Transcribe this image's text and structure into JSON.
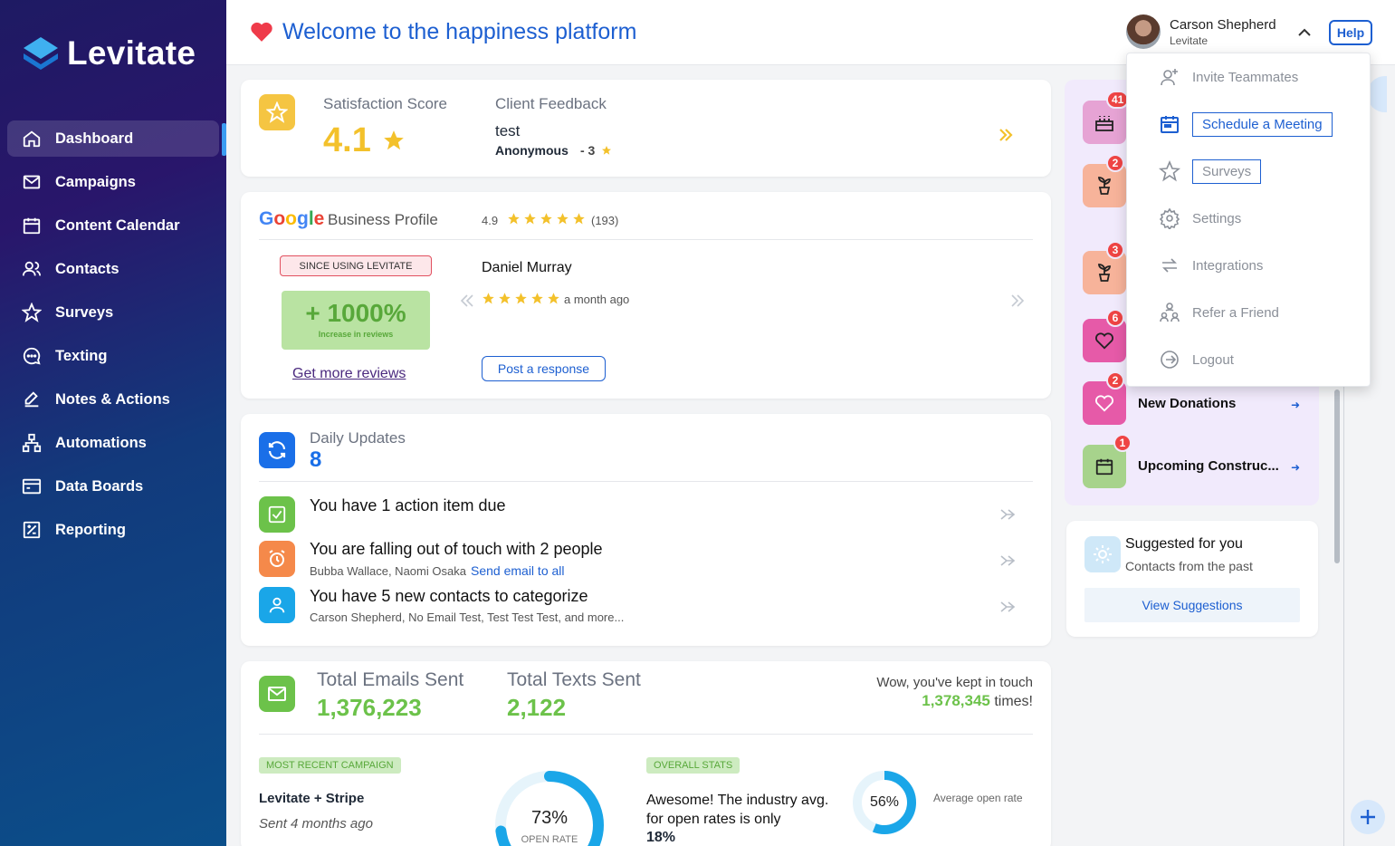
{
  "app": {
    "name": "Levitate"
  },
  "sidebar": {
    "items": [
      {
        "label": "Dashboard",
        "icon": "home-icon",
        "active": true
      },
      {
        "label": "Campaigns",
        "icon": "mail-icon"
      },
      {
        "label": "Content Calendar",
        "icon": "calendar-icon"
      },
      {
        "label": "Contacts",
        "icon": "users-icon"
      },
      {
        "label": "Surveys",
        "icon": "star-icon"
      },
      {
        "label": "Texting",
        "icon": "chat-icon"
      },
      {
        "label": "Notes & Actions",
        "icon": "pen-icon"
      },
      {
        "label": "Automations",
        "icon": "flow-icon"
      },
      {
        "label": "Data Boards",
        "icon": "board-icon"
      },
      {
        "label": "Reporting",
        "icon": "report-icon"
      }
    ]
  },
  "header": {
    "welcome": "Welcome to the happiness platform",
    "user_name": "Carson Shepherd",
    "user_org": "Levitate",
    "help": "Help"
  },
  "satisfaction": {
    "label": "Satisfaction Score",
    "score": "4.1",
    "feedback_label": "Client Feedback",
    "feedback_text": "test",
    "feedback_author": "Anonymous",
    "feedback_rating": "- 3"
  },
  "google": {
    "brand": "Google",
    "title": "Business Profile",
    "rating": "4.9",
    "review_count": "(193)",
    "since_label": "SINCE USING LEVITATE",
    "increase": "+ 1000%",
    "increase_sub": "Increase in reviews",
    "more_reviews": "Get more reviews",
    "reviewer": "Daniel Murray",
    "review_time": "a month ago",
    "post_response": "Post a response"
  },
  "daily": {
    "title": "Daily Updates",
    "count": "8",
    "items": [
      {
        "text": "You have 1 action item due",
        "sub": "",
        "link": ""
      },
      {
        "text": "You are falling out of touch with 2 people",
        "sub": "Bubba Wallace, Naomi Osaka",
        "link": "Send email to all"
      },
      {
        "text": "You have 5 new contacts to categorize",
        "sub": "Carson Shepherd, No Email Test, Test Test Test, and more...",
        "link": ""
      }
    ]
  },
  "stats": {
    "emails_label": "Total Emails Sent",
    "emails": "1,376,223",
    "texts_label": "Total Texts Sent",
    "texts": "2,122",
    "kept_prefix": "Wow, you've kept in touch",
    "kept_count": "1,378,345",
    "kept_suffix": "times!",
    "recent_badge": "MOST RECENT CAMPAIGN",
    "campaign_name": "Levitate + Stripe",
    "campaign_sent": "Sent 4 months ago",
    "open_rate": "73%",
    "open_rate_value": 0.73,
    "open_rate_label": "OPEN RATE",
    "overall_badge": "OVERALL STATS",
    "overall_text_1": "Awesome! The industry avg. for open rates is only",
    "overall_pct": "18%",
    "avg_open": "56%",
    "avg_open_value": 0.56,
    "avg_open_label": "Average open rate"
  },
  "right_panel": {
    "items": [
      {
        "badge": "41",
        "label": "",
        "color": "#e6a3d4"
      },
      {
        "badge": "2",
        "label": "",
        "color": "#f7b39a"
      },
      {
        "badge": "3",
        "label": "",
        "color": "#f7b39a"
      },
      {
        "badge": "6",
        "label": "",
        "color": "#e65aa8"
      },
      {
        "badge": "2",
        "label": "New Donations",
        "color": "#e65aa8"
      },
      {
        "badge": "1",
        "label": "Upcoming Construc...",
        "color": "#a7d38c"
      }
    ]
  },
  "suggested": {
    "title": "Suggested for you",
    "sub": "Contacts from the past",
    "button": "View Suggestions"
  },
  "dropdown": {
    "items": [
      {
        "label": "Invite Teammates",
        "icon": "add-user-icon"
      },
      {
        "label": "Schedule a Meeting",
        "icon": "calendar-icon"
      },
      {
        "label": "Surveys",
        "icon": "star-icon"
      },
      {
        "label": "Settings",
        "icon": "gear-icon"
      },
      {
        "label": "Integrations",
        "icon": "sync-icon"
      },
      {
        "label": "Refer a Friend",
        "icon": "refer-icon"
      },
      {
        "label": "Logout",
        "icon": "logout-icon"
      }
    ]
  }
}
